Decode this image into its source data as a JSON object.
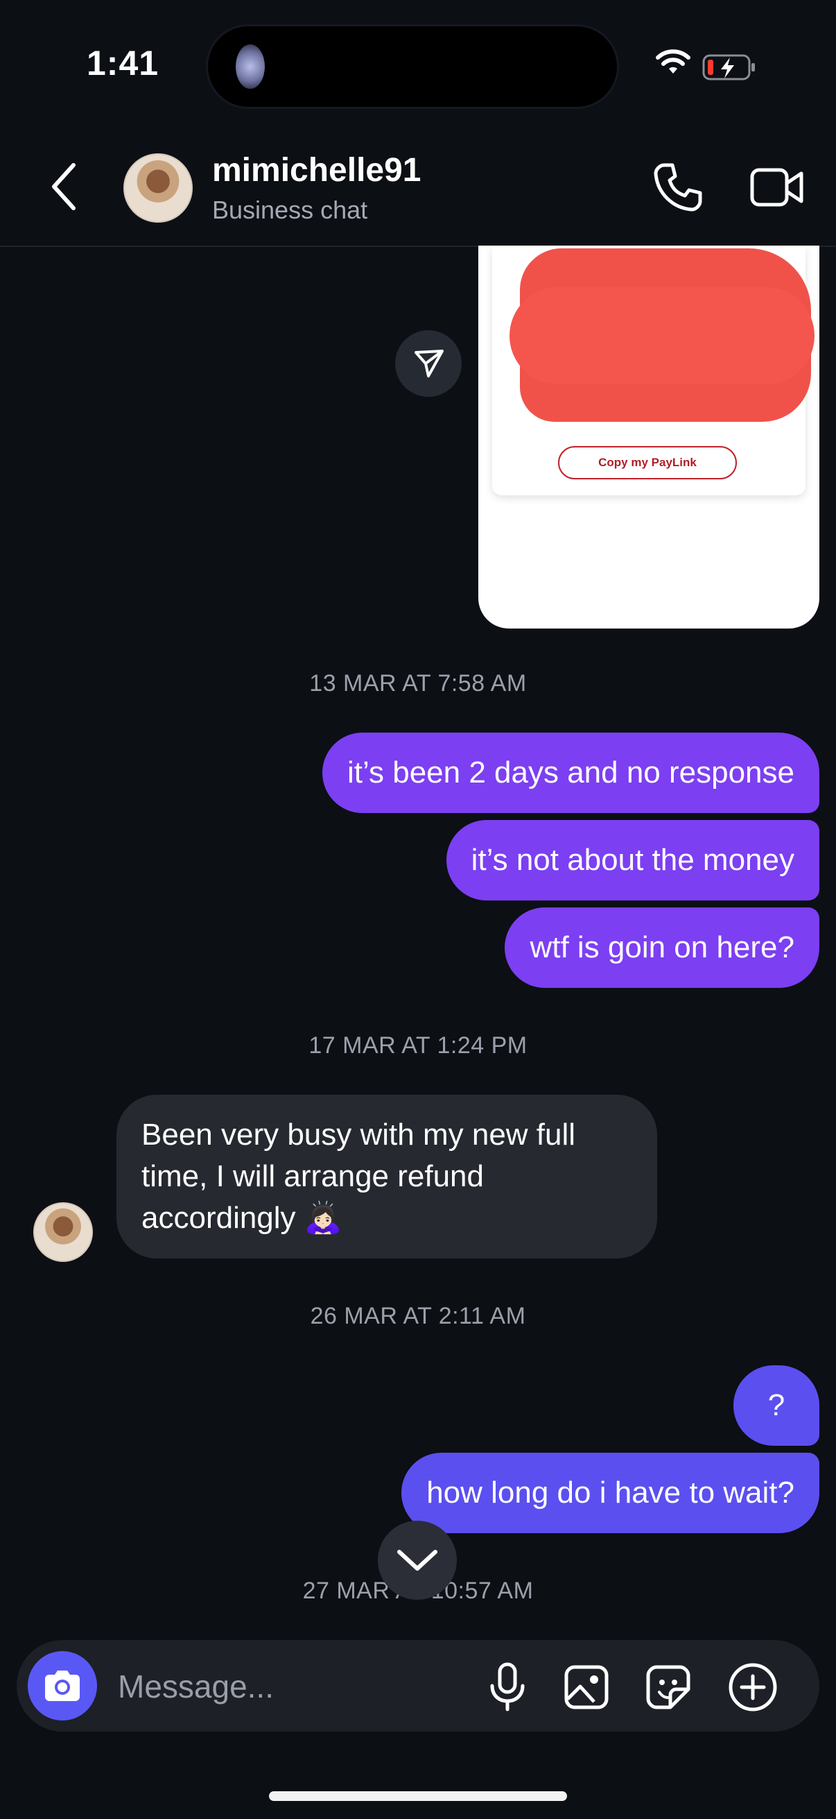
{
  "status_bar": {
    "time": "1:41"
  },
  "header": {
    "username": "mimichelle91",
    "subtitle": "Business chat",
    "icons": [
      "back-chevron-icon",
      "phone-icon",
      "video-camera-icon"
    ]
  },
  "shared_image": {
    "paylink_button": "Copy my PayLink"
  },
  "timestamps": {
    "t1": "13 MAR AT 7:58 AM",
    "t2": "17 MAR AT 1:24 PM",
    "t3": "26 MAR AT 2:11 AM",
    "t4": "27 MAR AT 10:57 AM"
  },
  "messages": {
    "m1": "it’s been 2 days and no response",
    "m2": "it’s not about the money",
    "m3": "wtf is goin on here?",
    "m4": "Been very busy with my new full time, I will arrange refund accordingly 🙇🏻‍♀️",
    "m5": "?",
    "m6": "how long do i have to wait?"
  },
  "composer": {
    "placeholder": "Message..."
  },
  "colors": {
    "background": "#0c0f14",
    "sent_bubble": "#7c3ff2",
    "sent_bubble_latest": "#5b4ff0",
    "received_bubble": "#262930",
    "camera_button": "#5a58f5"
  }
}
